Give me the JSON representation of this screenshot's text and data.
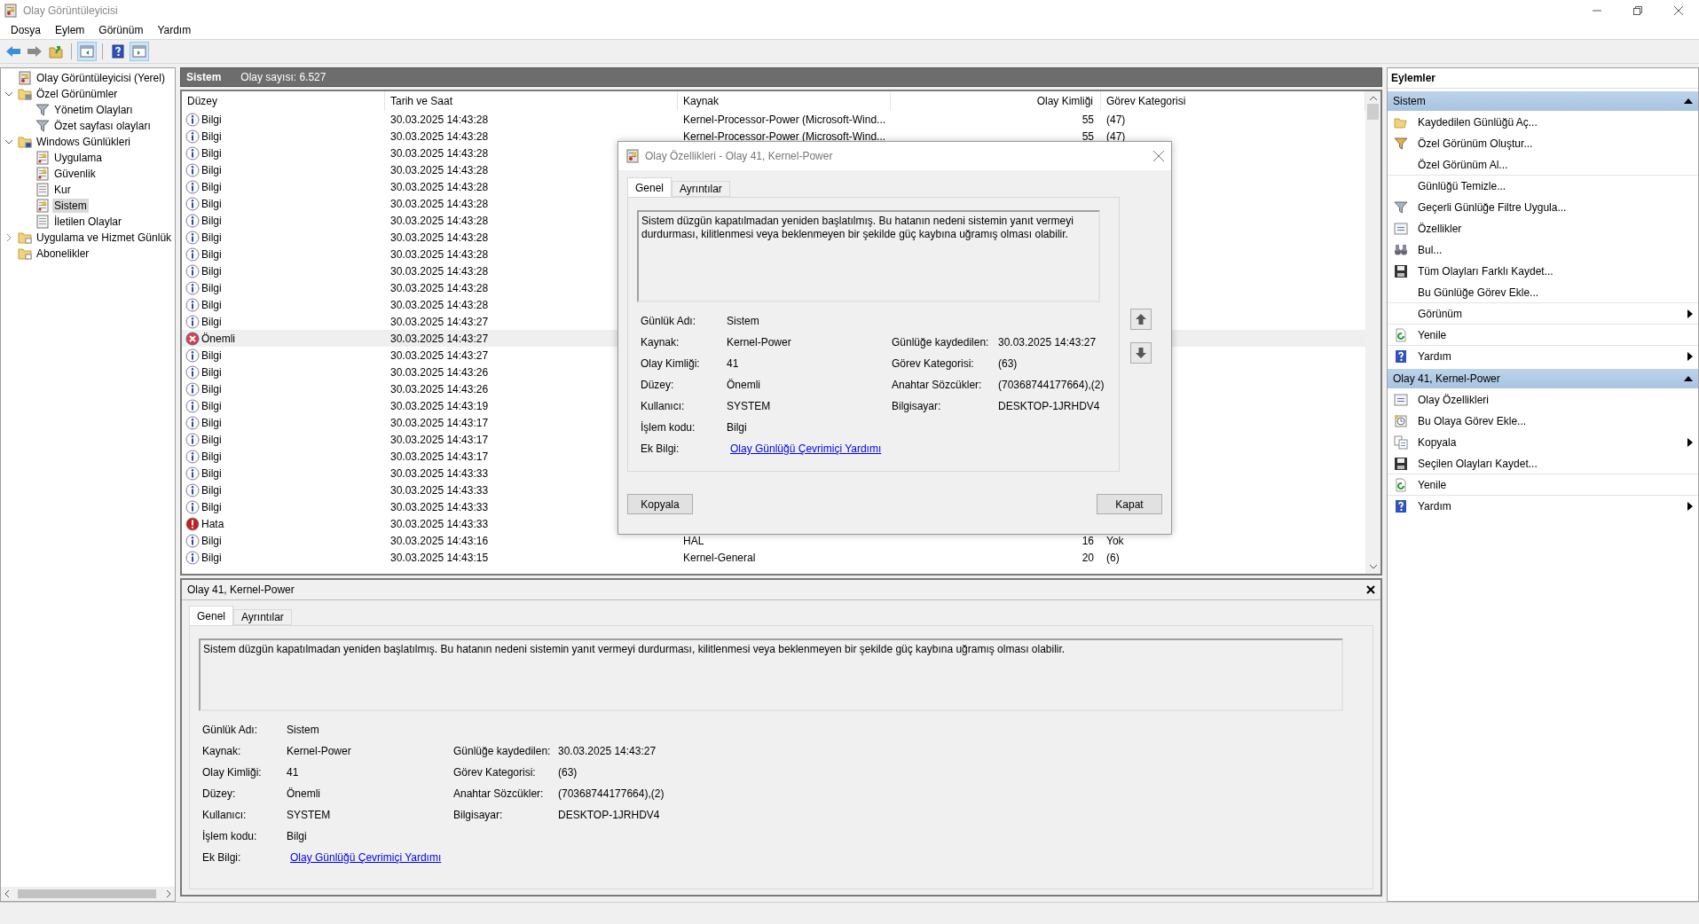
{
  "window": {
    "title": "Olay Görüntüleyicisi"
  },
  "menu": [
    "Dosya",
    "Eylem",
    "Görünüm",
    "Yardım"
  ],
  "toolbar": [
    {
      "kind": "back",
      "pressed": false
    },
    {
      "kind": "forward",
      "pressed": false
    },
    {
      "kind": "up",
      "pressed": false
    },
    {
      "kind": "tree",
      "pressed": true
    },
    {
      "kind": "help",
      "pressed": false
    },
    {
      "kind": "actions",
      "pressed": true
    }
  ],
  "tree": [
    {
      "label": "Olay Görüntüleyicisi (Yerel)",
      "kind": "viewer",
      "selected": false,
      "children": [
        {
          "label": "Özel Görünümler",
          "kind": "filter-folder",
          "expanded": true,
          "selected": false,
          "children": [
            {
              "label": "Yönetim Olayları",
              "kind": "filter",
              "selected": false
            },
            {
              "label": "Özet sayfası olayları",
              "kind": "filter",
              "selected": false
            }
          ]
        },
        {
          "label": "Windows Günlükleri",
          "kind": "pc-folder",
          "expanded": true,
          "selected": false,
          "children": [
            {
              "label": "Uygulama",
              "kind": "log-alert",
              "selected": false
            },
            {
              "label": "Güvenlik",
              "kind": "log-alert",
              "selected": false
            },
            {
              "label": "Kur",
              "kind": "log",
              "selected": false
            },
            {
              "label": "Sistem",
              "kind": "log-alert",
              "selected": true
            },
            {
              "label": "İletilen Olaylar",
              "kind": "log",
              "selected": false
            }
          ]
        },
        {
          "label": "Uygulama ve Hizmet Günlük",
          "kind": "folder",
          "expanded": false,
          "selected": false
        },
        {
          "label": "Abonelikler",
          "kind": "sub-folder",
          "selected": false
        }
      ]
    }
  ],
  "log_header": {
    "name": "Sistem",
    "count": "Olay sayısı: 6.527"
  },
  "table": {
    "columns": [
      "Düzey",
      "Tarih ve Saat",
      "Kaynak",
      "Olay Kimliği",
      "Görev Kategorisi"
    ],
    "rows": [
      {
        "kind": "info",
        "level": "Bilgi",
        "date": "30.03.2025 14:43:28",
        "source": "Kernel-Processor-Power (Microsoft-Wind...",
        "event_id": "55",
        "category": "(47)",
        "selected": false
      },
      {
        "kind": "info",
        "level": "Bilgi",
        "date": "30.03.2025 14:43:28",
        "source": "Kernel-Processor-Power (Microsoft-Wind...",
        "event_id": "55",
        "category": "(47)",
        "selected": false
      },
      {
        "kind": "info",
        "level": "Bilgi",
        "date": "30.03.2025 14:43:28",
        "selected": false
      },
      {
        "kind": "info",
        "level": "Bilgi",
        "date": "30.03.2025 14:43:28",
        "selected": false
      },
      {
        "kind": "info",
        "level": "Bilgi",
        "date": "30.03.2025 14:43:28",
        "selected": false
      },
      {
        "kind": "info",
        "level": "Bilgi",
        "date": "30.03.2025 14:43:28",
        "selected": false
      },
      {
        "kind": "info",
        "level": "Bilgi",
        "date": "30.03.2025 14:43:28",
        "selected": false
      },
      {
        "kind": "info",
        "level": "Bilgi",
        "date": "30.03.2025 14:43:28",
        "selected": false
      },
      {
        "kind": "info",
        "level": "Bilgi",
        "date": "30.03.2025 14:43:28",
        "selected": false
      },
      {
        "kind": "info",
        "level": "Bilgi",
        "date": "30.03.2025 14:43:28",
        "selected": false
      },
      {
        "kind": "info",
        "level": "Bilgi",
        "date": "30.03.2025 14:43:28",
        "selected": false
      },
      {
        "kind": "info",
        "level": "Bilgi",
        "date": "30.03.2025 14:43:28",
        "selected": false
      },
      {
        "kind": "info",
        "level": "Bilgi",
        "date": "30.03.2025 14:43:27",
        "selected": false
      },
      {
        "kind": "critical",
        "level": "Önemli",
        "date": "30.03.2025 14:43:27",
        "selected": true
      },
      {
        "kind": "info",
        "level": "Bilgi",
        "date": "30.03.2025 14:43:27",
        "selected": false
      },
      {
        "kind": "info",
        "level": "Bilgi",
        "date": "30.03.2025 14:43:26",
        "selected": false
      },
      {
        "kind": "info",
        "level": "Bilgi",
        "date": "30.03.2025 14:43:26",
        "selected": false
      },
      {
        "kind": "info",
        "level": "Bilgi",
        "date": "30.03.2025 14:43:19",
        "selected": false
      },
      {
        "kind": "info",
        "level": "Bilgi",
        "date": "30.03.2025 14:43:17",
        "selected": false
      },
      {
        "kind": "info",
        "level": "Bilgi",
        "date": "30.03.2025 14:43:17",
        "selected": false
      },
      {
        "kind": "info",
        "level": "Bilgi",
        "date": "30.03.2025 14:43:17",
        "selected": false
      },
      {
        "kind": "info",
        "level": "Bilgi",
        "date": "30.03.2025 14:43:33",
        "selected": false
      },
      {
        "kind": "info",
        "level": "Bilgi",
        "date": "30.03.2025 14:43:33",
        "selected": false
      },
      {
        "kind": "info",
        "level": "Bilgi",
        "date": "30.03.2025 14:43:33",
        "selected": false
      },
      {
        "kind": "error",
        "level": "Hata",
        "date": "30.03.2025 14:43:33",
        "selected": false
      },
      {
        "kind": "info",
        "level": "Bilgi",
        "date": "30.03.2025 14:43:16",
        "source": "HAL",
        "event_id": "16",
        "category": "Yok",
        "selected": false
      },
      {
        "kind": "info",
        "level": "Bilgi",
        "date": "30.03.2025 14:43:15",
        "source": "Kernel-General",
        "event_id": "20",
        "category": "(6)",
        "selected": false
      }
    ]
  },
  "dialog": {
    "title": "Olay Özellikleri - Olay 41, Kernel-Power",
    "tabs": [
      {
        "label": "Genel",
        "selected": true
      },
      {
        "label": "Ayrıntılar",
        "selected": false
      }
    ],
    "description": "Sistem düzgün kapatılmadan yeniden başlatılmış. Bu hatanın nedeni sistemin yanıt vermeyi durdurması, kilitlenmesi veya beklenmeyen bir şekilde güç kaybına uğramış olması olabilir.",
    "fields": [
      {
        "label": "Günlük Adı:",
        "value": "Sistem"
      },
      {
        "label": "Kaynak:",
        "value": "Kernel-Power",
        "label2": "Günlüğe kaydedilen:",
        "value2": "30.03.2025 14:43:27"
      },
      {
        "label": "Olay Kimliği:",
        "value": "41",
        "label2": "Görev Kategorisi:",
        "value2": "(63)"
      },
      {
        "label": "Düzey:",
        "value": "Önemli",
        "label2": "Anahtar Sözcükler:",
        "value2": "(70368744177664),(2)"
      },
      {
        "label": "Kullanıcı:",
        "value": "SYSTEM",
        "label2": "Bilgisayar:",
        "value2": "DESKTOP-1JRHDV4"
      },
      {
        "label": "İşlem kodu:",
        "value": "Bilgi"
      },
      {
        "label": "Ek Bilgi:",
        "link": "Olay Günlüğü Çevrimiçi Yardımı"
      }
    ],
    "buttons": [
      "Kopyala",
      "Kapat"
    ]
  },
  "preview": {
    "title": "Olay 41, Kernel-Power",
    "tabs": [
      {
        "label": "Genel",
        "selected": true
      },
      {
        "label": "Ayrıntılar",
        "selected": false
      }
    ],
    "description": "Sistem düzgün kapatılmadan yeniden başlatılmış. Bu hatanın nedeni sistemin yanıt vermeyi durdurması, kilitlenmesi veya beklenmeyen bir şekilde güç kaybına uğramış olması olabilir.",
    "fields": [
      {
        "label": "Günlük Adı:",
        "value": "Sistem"
      },
      {
        "label": "Kaynak:",
        "value": "Kernel-Power",
        "label2": "Günlüğe kaydedilen:",
        "value2": "30.03.2025 14:43:27"
      },
      {
        "label": "Olay Kimliği:",
        "value": "41",
        "label2": "Görev Kategorisi:",
        "value2": "(63)"
      },
      {
        "label": "Düzey:",
        "value": "Önemli",
        "label2": "Anahtar Sözcükler:",
        "value2": "(70368744177664),(2)"
      },
      {
        "label": "Kullanıcı:",
        "value": "SYSTEM",
        "label2": "Bilgisayar:",
        "value2": "DESKTOP-1JRHDV4"
      },
      {
        "label": "İşlem kodu:",
        "value": "Bilgi"
      },
      {
        "label": "Ek Bilgi:",
        "link": "Olay Günlüğü Çevrimiçi Yardımı"
      }
    ]
  },
  "actions": {
    "title": "Eylemler",
    "sections": [
      {
        "title": "Sistem",
        "expanded": true,
        "items": [
          {
            "label": "Kaydedilen Günlüğü Aç...",
            "kind": "open",
            "submenu": false,
            "separator": false
          },
          {
            "label": "Özel Görünüm Oluştur...",
            "kind": "filter-color",
            "submenu": false,
            "separator": false
          },
          {
            "label": "Özel Görünüm Al...",
            "kind": "plain",
            "submenu": false,
            "separator": false
          },
          {
            "label": "Günlüğü Temizle...",
            "kind": "plain",
            "submenu": false,
            "separator": true
          },
          {
            "label": "Geçerli Günlüğe Filtre Uygula...",
            "kind": "filter",
            "submenu": false,
            "separator": false
          },
          {
            "label": "Özellikler",
            "kind": "properties",
            "submenu": false,
            "separator": false
          },
          {
            "label": "Bul...",
            "kind": "find",
            "submenu": false,
            "separator": false
          },
          {
            "label": "Tüm Olayları Farklı Kaydet...",
            "kind": "save",
            "submenu": false,
            "separator": false
          },
          {
            "label": "Bu Günlüğe Görev Ekle...",
            "kind": "plain",
            "submenu": false,
            "separator": false
          },
          {
            "label": "Görünüm",
            "kind": "plain",
            "submenu": true,
            "separator": true
          },
          {
            "label": "Yenile",
            "kind": "refresh",
            "submenu": false,
            "separator": true
          },
          {
            "label": "Yardım",
            "kind": "help",
            "submenu": true,
            "separator": true
          }
        ]
      },
      {
        "title": "Olay 41, Kernel-Power",
        "expanded": true,
        "items": [
          {
            "label": "Olay Özellikleri",
            "kind": "properties",
            "submenu": false,
            "separator": false
          },
          {
            "label": "Bu Olaya Görev Ekle...",
            "kind": "task",
            "submenu": false,
            "separator": false
          },
          {
            "label": "Kopyala",
            "kind": "copy",
            "submenu": true,
            "separator": false
          },
          {
            "label": "Seçilen Olayları Kaydet...",
            "kind": "save",
            "submenu": false,
            "separator": false
          },
          {
            "label": "Yenile",
            "kind": "refresh",
            "submenu": false,
            "separator": true
          },
          {
            "label": "Yardım",
            "kind": "help",
            "submenu": true,
            "separator": true
          }
        ]
      }
    ]
  }
}
